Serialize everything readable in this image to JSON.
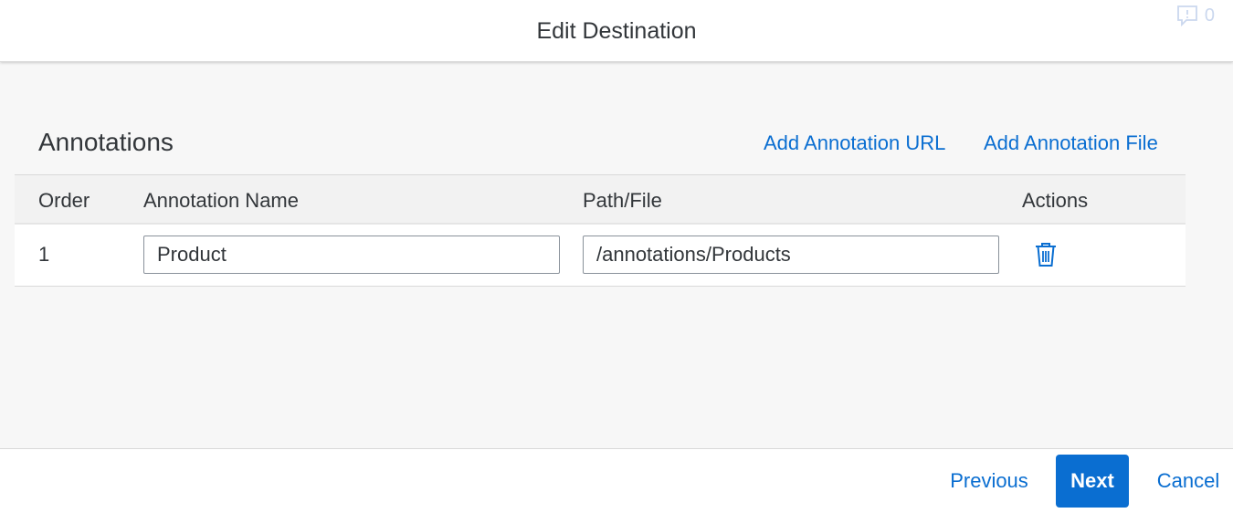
{
  "header": {
    "title": "Edit Destination",
    "feedback_icon": "feedback-icon",
    "feedback_count": "0"
  },
  "section": {
    "title": "Annotations",
    "add_url_label": "Add Annotation URL",
    "add_file_label": "Add Annotation File"
  },
  "table": {
    "columns": [
      "Order",
      "Annotation Name",
      "Path/File",
      "Actions"
    ],
    "rows": [
      {
        "order": "1",
        "name": "Product",
        "path": "/annotations/Products",
        "action_icon": "trash-icon"
      }
    ]
  },
  "footer": {
    "previous_label": "Previous",
    "next_label": "Next",
    "cancel_label": "Cancel"
  },
  "colors": {
    "accent": "#0a6ed1",
    "text": "#32363a",
    "background": "#f7f7f7"
  }
}
